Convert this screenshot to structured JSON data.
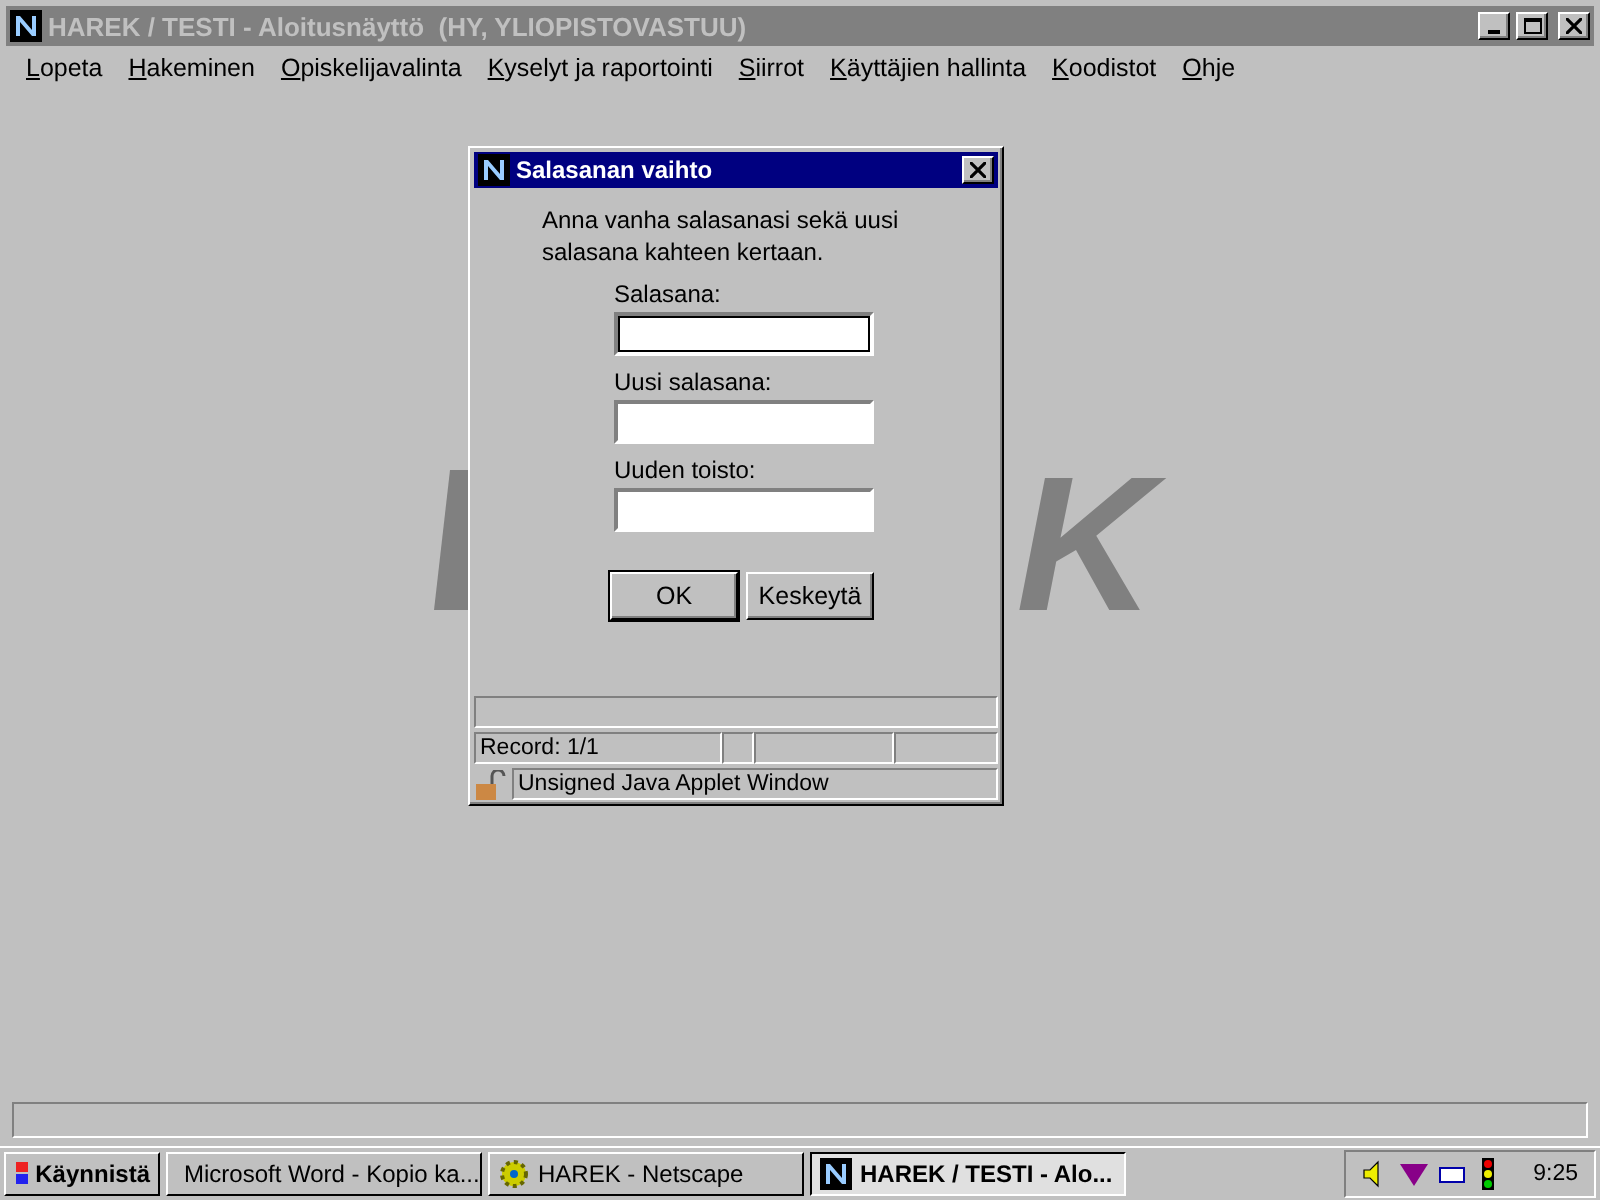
{
  "window": {
    "title": "HAREK / TESTI - Aloitusnäyttö  (HY, YLIOPISTOVASTUU)",
    "active": false
  },
  "menu": [
    "Lopeta",
    "Hakeminen",
    "Opiskelijavalinta",
    "Kyselyt ja raportointi",
    "Siirrot",
    "Käyttäjien hallinta",
    "Koodistot",
    "Ohje"
  ],
  "background_logo": "K",
  "dialog": {
    "title": "Salasanan vaihto",
    "intro": "Anna vanha salasanasi sekä uusi salasana kahteen kertaan.",
    "fields": [
      {
        "label": "Salasana:",
        "focused": true
      },
      {
        "label": "Uusi salasana:",
        "focused": false
      },
      {
        "label": "Uuden toisto:",
        "focused": false
      }
    ],
    "buttons": [
      {
        "label": "OK",
        "default": true
      },
      {
        "label": "Keskeytä",
        "default": false
      }
    ],
    "record": "Record: 1/1",
    "applet_note": "Unsigned Java Applet Window"
  },
  "taskbar": {
    "start": "Käynnistä",
    "tasks": [
      {
        "label": "Microsoft Word - Kopio ka...",
        "kind": "word",
        "selected": false
      },
      {
        "label": "HAREK - Netscape",
        "kind": "gear",
        "selected": false
      },
      {
        "label": "HAREK / TESTI - Alo...",
        "kind": "netscape",
        "selected": true
      }
    ],
    "clock": "9:25"
  }
}
